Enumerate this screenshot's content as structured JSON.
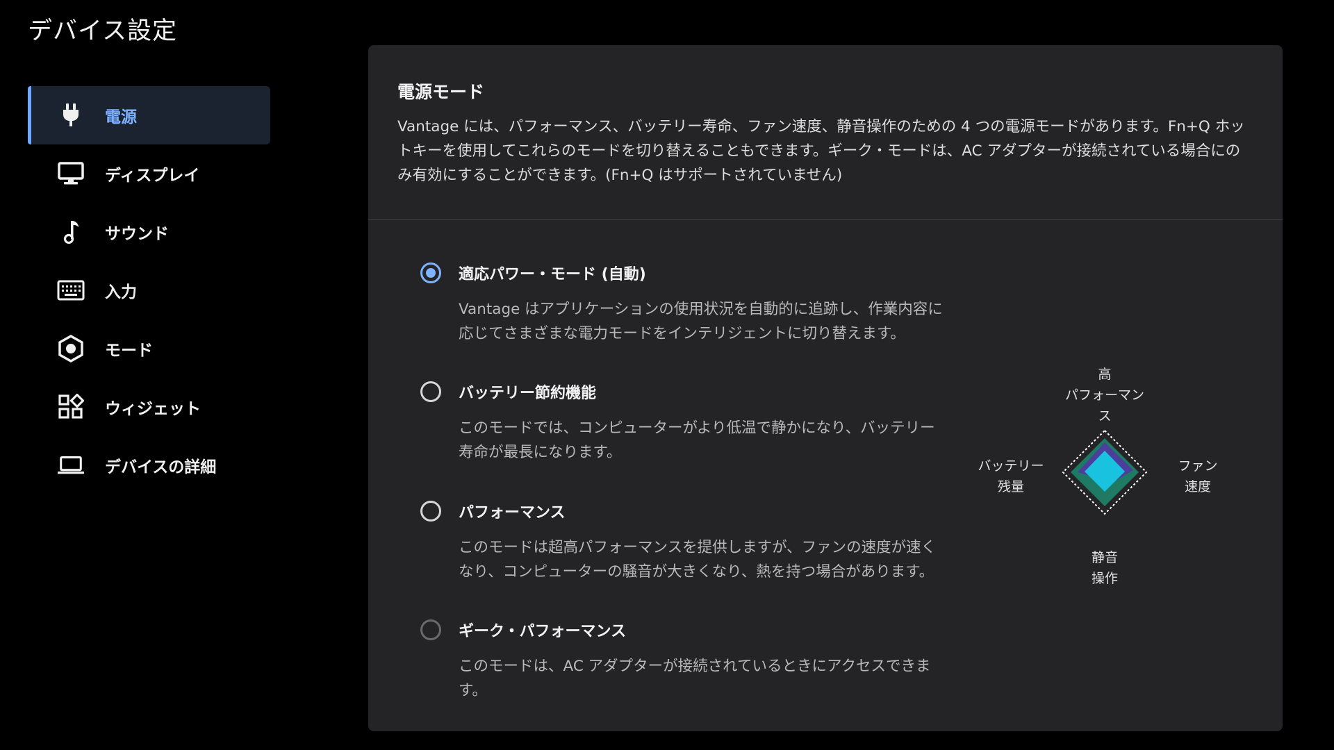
{
  "page": {
    "title": "デバイス設定"
  },
  "sidebar": {
    "items": [
      {
        "label": "電源",
        "icon": "plug-icon",
        "active": true
      },
      {
        "label": "ディスプレイ",
        "icon": "monitor-icon"
      },
      {
        "label": "サウンド",
        "icon": "music-note-icon"
      },
      {
        "label": "入力",
        "icon": "keyboard-icon"
      },
      {
        "label": "モード",
        "icon": "hexagon-mode-icon"
      },
      {
        "label": "ウィジェット",
        "icon": "widgets-icon"
      },
      {
        "label": "デバイスの詳細",
        "icon": "laptop-icon"
      }
    ]
  },
  "power_mode": {
    "title": "電源モード",
    "description": "Vantage には、パフォーマンス、バッテリー寿命、ファン速度、静音操作のための 4 つの電源モードがあります。Fn+Q ホットキーを使用してこれらのモードを切り替えることもできます。ギーク・モードは、AC アダプターが接続されている場合にのみ有効にすることができます。(Fn+Q はサポートされていません)",
    "options": [
      {
        "title": "適応パワー・モード (自動)",
        "description": "Vantage はアプリケーションの使用状況を自動的に追跡し、作業内容に応じてさまざまな電力モードをインテリジェントに切り替えます。",
        "selected": true
      },
      {
        "title": "バッテリー節約機能",
        "description": "このモードでは、コンピューターがより低温で静かになり、バッテリー寿命が最長になります。",
        "selected": false
      },
      {
        "title": "パフォーマンス",
        "description": "このモードは超高パフォーマンスを提供しますが、ファンの速度が速くなり、コンピューターの騒音が大きくなり、熱を持つ場合があります。",
        "selected": false
      },
      {
        "title": "ギーク・パフォーマンス",
        "description": "このモードは、AC アダプターが接続されているときにアクセスできます。",
        "selected": false,
        "disabled": true
      }
    ]
  },
  "radar": {
    "labels": {
      "top": "高\nパフォーマンス",
      "right": "ファン\n速度",
      "bottom": "静音\n操作",
      "left": "バッテリー\n残量"
    },
    "colors": {
      "outline": "#ffffff",
      "purple": "#4b3f9e",
      "green": "#1f7a63",
      "cyan": "#19c3e0"
    }
  },
  "colors": {
    "accent": "#7fb2ff",
    "panel": "#242426",
    "active_nav_bg": "#1b2330"
  }
}
